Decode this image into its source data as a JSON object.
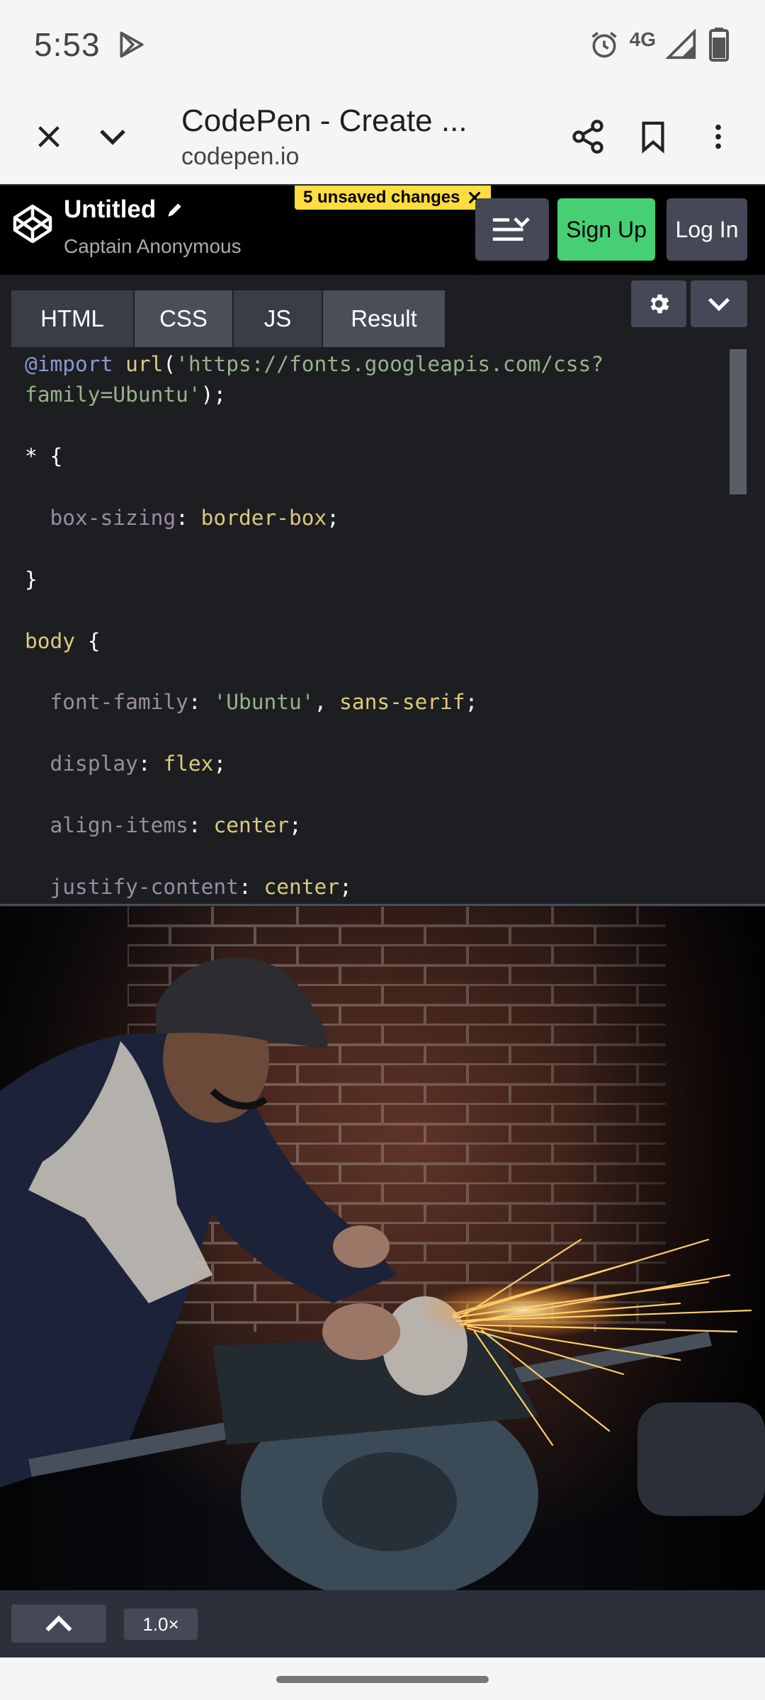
{
  "status_bar": {
    "time": "5:53",
    "network": "4G",
    "icons": [
      "play-store-icon",
      "alarm-icon",
      "signal-icon",
      "battery-icon"
    ]
  },
  "toolbar": {
    "title": "CodePen - Create ...",
    "url": "codepen.io",
    "icons": [
      "close-icon",
      "chevron-down-icon",
      "share-icon",
      "bookmark-icon",
      "more-vert-icon"
    ]
  },
  "codepen_header": {
    "pen_title": "Untitled",
    "author": "Captain Anonymous",
    "unsaved_badge": "5 unsaved changes",
    "signup_label": "Sign Up",
    "login_label": "Log In",
    "colors": {
      "signup": "#47cf73",
      "badge": "#ffdd40",
      "button": "#444857"
    }
  },
  "editor": {
    "tabs": [
      {
        "label": "HTML"
      },
      {
        "label": "CSS"
      },
      {
        "label": "JS"
      },
      {
        "label": "Result"
      }
    ],
    "active_tab": "CSS",
    "code": {
      "import_kw": "@import",
      "url_fn": "url",
      "url_str_1": "'https://fonts.googleapis.com/css?",
      "url_str_2": "family=Ubuntu'",
      "universal_selector": "*",
      "box_sizing_prop": "box-sizing",
      "box_sizing_val": "border-box",
      "body_selector": "body",
      "font_family_prop": "font-family",
      "font_family_str": "'Ubuntu'",
      "font_family_val": "sans-serif",
      "display_prop": "display",
      "display_val": "flex",
      "align_items_prop": "align-items",
      "align_items_val": "center",
      "justify_content_prop": "justify-content",
      "justify_content_val": "center"
    }
  },
  "bottom_bar": {
    "zoom": "1.0×"
  }
}
